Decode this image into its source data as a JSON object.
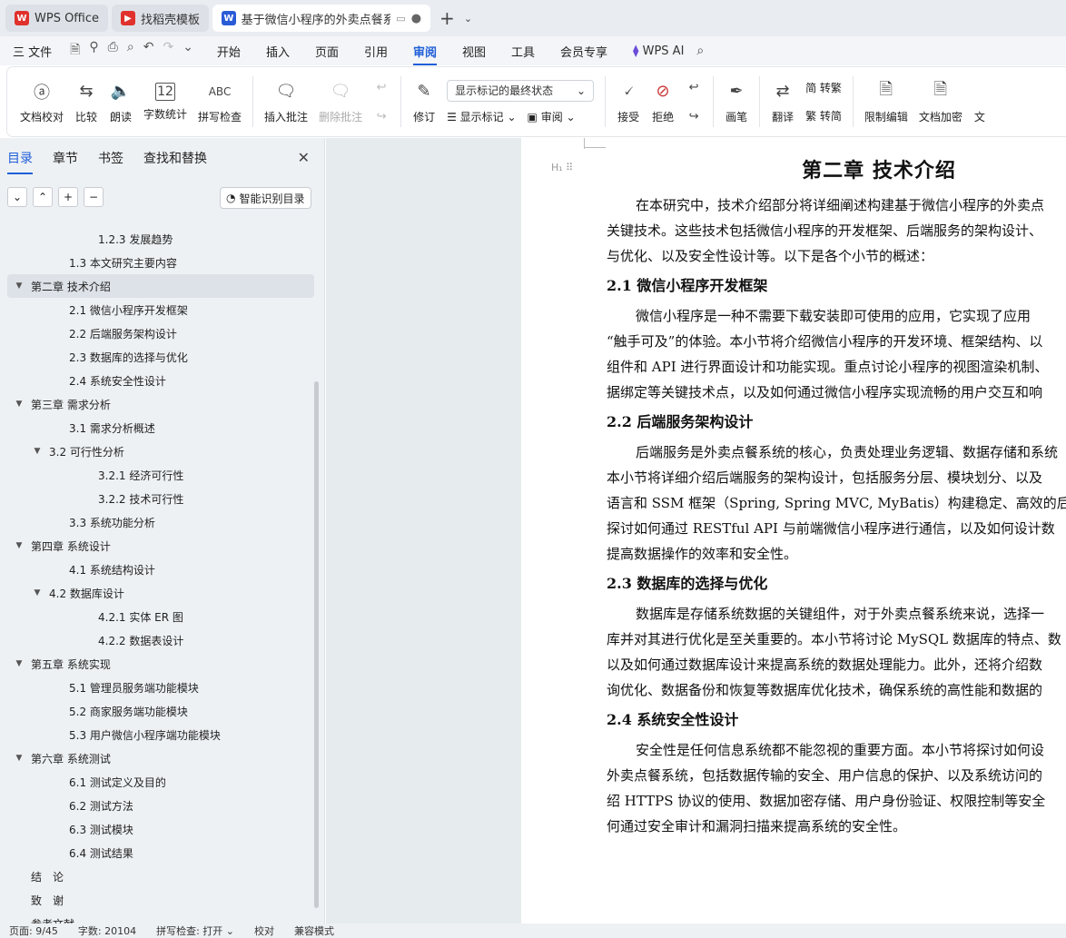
{
  "tabs": {
    "home": "WPS Office",
    "templates": "找稻壳模板",
    "doc": "基于微信小程序的外卖点餐系"
  },
  "menu": {
    "file": "三 文件",
    "items": [
      "开始",
      "插入",
      "页面",
      "引用",
      "审阅",
      "视图",
      "工具",
      "会员专享"
    ],
    "ai": "WPS AI"
  },
  "ribbon": {
    "proofread": "文档校对",
    "compare": "比较",
    "read": "朗读",
    "wordcount": "字数统计",
    "spell": "拼写检查",
    "insert_comment": "插入批注",
    "delete_comment": "删除批注",
    "revise": "修订",
    "markup_state": "显示标记的最终状态",
    "show_markup": "显示标记",
    "review": "审阅",
    "accept": "接受",
    "reject": "拒绝",
    "pen": "画笔",
    "translate": "翻译",
    "to_traditional": "简 转繁",
    "to_simplified": "繁 转简",
    "restrict": "限制编辑",
    "encrypt": "文档加密",
    "more": "文"
  },
  "sidebar": {
    "tabs": [
      "目录",
      "章节",
      "书签",
      "查找和替换"
    ],
    "smart": "智能识别目录",
    "toc": [
      {
        "t": "1.2.3 发展趋势",
        "lvl": 3,
        "tri": ""
      },
      {
        "t": "1.3 本文研究主要内容",
        "lvl": 2,
        "tri": ""
      },
      {
        "t": "第二章 技术介绍",
        "lvl": 1,
        "tri": "▼",
        "sel": true
      },
      {
        "t": "2.1 微信小程序开发框架",
        "lvl": 2,
        "tri": ""
      },
      {
        "t": "2.2 后端服务架构设计",
        "lvl": 2,
        "tri": ""
      },
      {
        "t": "2.3 数据库的选择与优化",
        "lvl": 2,
        "tri": ""
      },
      {
        "t": "2.4 系统安全性设计",
        "lvl": 2,
        "tri": ""
      },
      {
        "t": "第三章 需求分析",
        "lvl": 1,
        "tri": "▼"
      },
      {
        "t": "3.1 需求分析概述",
        "lvl": 2,
        "tri": ""
      },
      {
        "t": "3.2 可行性分析",
        "lvl": 2,
        "tri": "▼"
      },
      {
        "t": "3.2.1 经济可行性",
        "lvl": 3,
        "tri": ""
      },
      {
        "t": "3.2.2 技术可行性",
        "lvl": 3,
        "tri": ""
      },
      {
        "t": "3.3 系统功能分析",
        "lvl": 2,
        "tri": ""
      },
      {
        "t": "第四章 系统设计",
        "lvl": 1,
        "tri": "▼"
      },
      {
        "t": "4.1 系统结构设计",
        "lvl": 2,
        "tri": ""
      },
      {
        "t": "4.2 数据库设计",
        "lvl": 2,
        "tri": "▼"
      },
      {
        "t": "4.2.1 实体 ER 图",
        "lvl": 3,
        "tri": ""
      },
      {
        "t": "4.2.2 数据表设计",
        "lvl": 3,
        "tri": ""
      },
      {
        "t": "第五章 系统实现",
        "lvl": 1,
        "tri": "▼"
      },
      {
        "t": "5.1 管理员服务端功能模块",
        "lvl": 2,
        "tri": ""
      },
      {
        "t": "5.2 商家服务端功能模块",
        "lvl": 2,
        "tri": ""
      },
      {
        "t": "5.3 用户微信小程序端功能模块",
        "lvl": 2,
        "tri": ""
      },
      {
        "t": "第六章 系统测试",
        "lvl": 1,
        "tri": "▼"
      },
      {
        "t": "6.1 测试定义及目的",
        "lvl": 2,
        "tri": ""
      },
      {
        "t": "6.2 测试方法",
        "lvl": 2,
        "tri": ""
      },
      {
        "t": "6.3 测试模块",
        "lvl": 2,
        "tri": ""
      },
      {
        "t": "6.4 测试结果",
        "lvl": 2,
        "tri": ""
      },
      {
        "t": "结　论",
        "lvl": 1,
        "tri": ""
      },
      {
        "t": "致　谢",
        "lvl": 1,
        "tri": ""
      },
      {
        "t": "参考文献",
        "lvl": 1,
        "tri": ""
      }
    ]
  },
  "doc": {
    "title": "第二章 技术介绍",
    "intro": [
      "在本研究中，技术介绍部分将详细阐述构建基于微信小程序的外卖点",
      "关键技术。这些技术包括微信小程序的开发框架、后端服务的架构设计、",
      "与优化、以及安全性设计等。以下是各个小节的概述："
    ],
    "h21": "2.1  微信小程序开发框架",
    "p21": [
      "微信小程序是一种不需要下载安装即可使用的应用，它实现了应用",
      "“触手可及”的体验。本小节将介绍微信小程序的开发环境、框架结构、以",
      "组件和 API 进行界面设计和功能实现。重点讨论小程序的视图渲染机制、",
      "据绑定等关键技术点，以及如何通过微信小程序实现流畅的用户交互和响"
    ],
    "h22": "2.2  后端服务架构设计",
    "p22": [
      "后端服务是外卖点餐系统的核心，负责处理业务逻辑、数据存储和系统",
      "本小节将详细介绍后端服务的架构设计，包括服务分层、模块划分、以及",
      "语言和 SSM 框架（Spring, Spring MVC, MyBatis）构建稳定、高效的后端",
      "探讨如何通过 RESTful API 与前端微信小程序进行通信，以及如何设计数",
      "提高数据操作的效率和安全性。"
    ],
    "h23": "2.3  数据库的选择与优化",
    "p23": [
      "数据库是存储系统数据的关键组件，对于外卖点餐系统来说，选择一",
      "库并对其进行优化是至关重要的。本小节将讨论 MySQL 数据库的特点、数",
      "以及如何通过数据库设计来提高系统的数据处理能力。此外，还将介绍数",
      "询优化、数据备份和恢复等数据库优化技术，确保系统的高性能和数据的"
    ],
    "h24": "2.4  系统安全性设计",
    "p24": [
      "安全性是任何信息系统都不能忽视的重要方面。本小节将探讨如何设",
      "外卖点餐系统，包括数据传输的安全、用户信息的保护、以及系统访问的",
      "绍 HTTPS 协议的使用、数据加密存储、用户身份验证、权限控制等安全",
      "何通过安全审计和漏洞扫描来提高系统的安全性。"
    ]
  },
  "status": {
    "page": "页面: 9/45",
    "words": "字数: 20104",
    "spell": "拼写检查: 打开",
    "proof": "校对",
    "compat": "兼容模式"
  }
}
